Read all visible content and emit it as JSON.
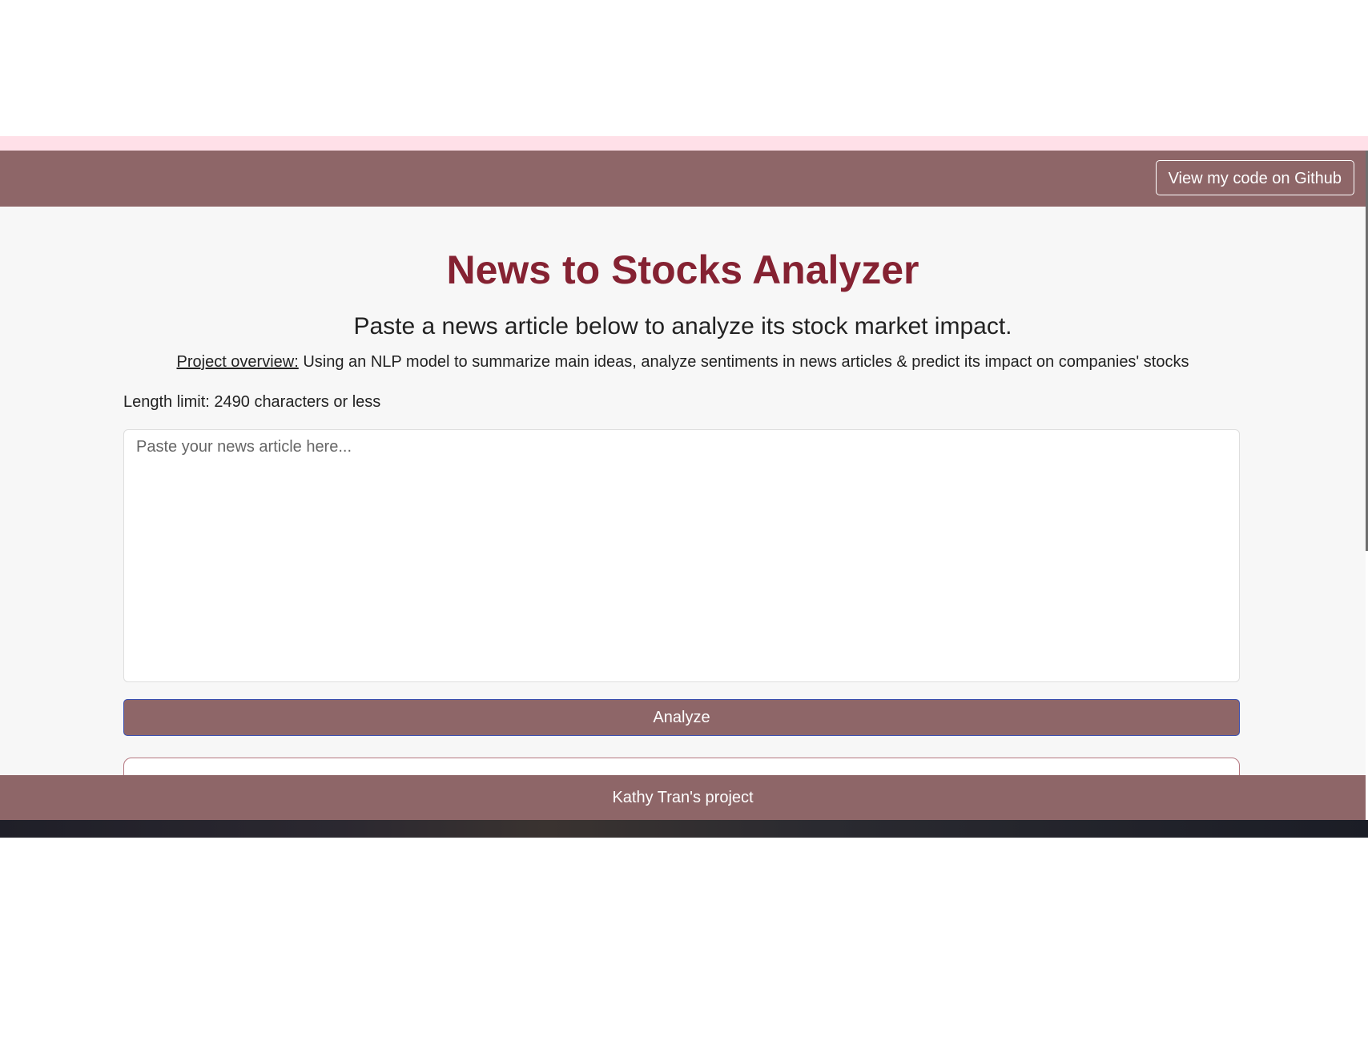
{
  "header": {
    "github_button_label": "View my code on Github"
  },
  "main": {
    "title": "News to Stocks Analyzer",
    "subtitle": "Paste a news article below to analyze its stock market impact.",
    "overview_label": "Project overview:",
    "overview_text": " Using an NLP model to summarize main ideas, analyze sentiments in news articles & predict its impact on companies' stocks",
    "length_limit": "Length limit: 2490 characters or less",
    "article_input": {
      "value": "",
      "placeholder": "Paste your news article here..."
    },
    "analyze_button_label": "Analyze"
  },
  "footer": {
    "text": "Kathy Tran's project"
  },
  "colors": {
    "brand": "#8e6668",
    "title": "#852232",
    "background": "#f7f7f7"
  }
}
